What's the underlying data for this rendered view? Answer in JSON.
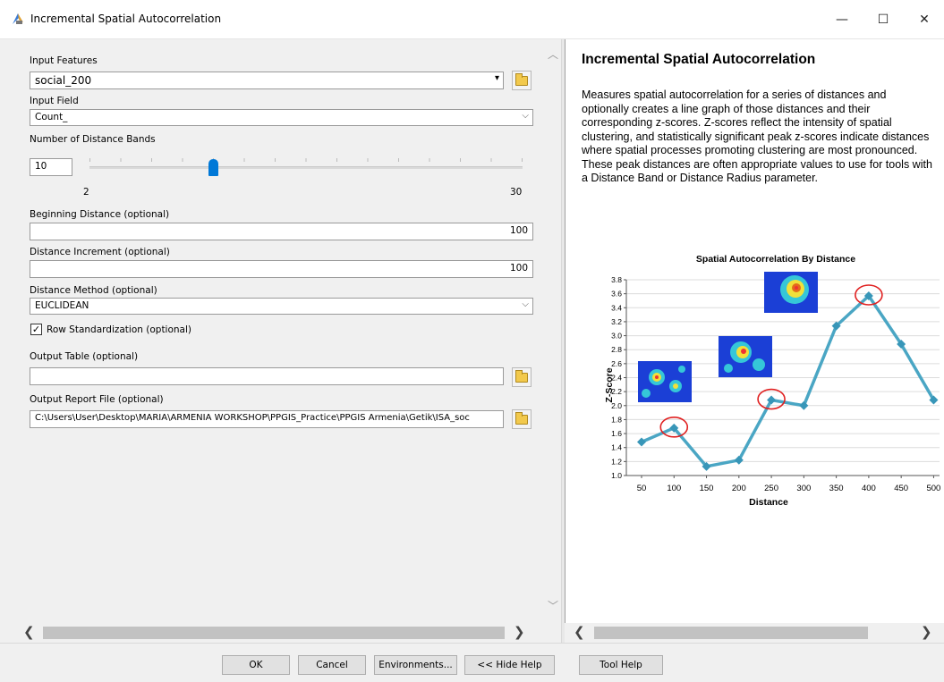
{
  "window": {
    "title": "Incremental Spatial Autocorrelation",
    "min_glyph": "—",
    "max_glyph": "☐",
    "close_glyph": "✕"
  },
  "form": {
    "input_features": {
      "label": "Input Features",
      "value": "social_200"
    },
    "input_field": {
      "label": "Input Field",
      "value": "Count_"
    },
    "distance_bands": {
      "label": "Number of Distance Bands",
      "value": "10",
      "min": "2",
      "max": "30",
      "position": 0.2857
    },
    "beginning_distance": {
      "label": "Beginning Distance (optional)",
      "value": "100"
    },
    "distance_increment": {
      "label": "Distance Increment (optional)",
      "value": "100"
    },
    "distance_method": {
      "label": "Distance Method (optional)",
      "value": "EUCLIDEAN"
    },
    "row_standardization": {
      "label": "Row Standardization (optional)",
      "checked": true
    },
    "output_table": {
      "label": "Output Table (optional)",
      "value": ""
    },
    "output_report": {
      "label": "Output Report File (optional)",
      "value": "C:\\Users\\User\\Desktop\\MARIA\\ARMENIA WORKSHOP\\PPGIS_Practice\\PPGIS Armenia\\Getik\\ISA_soc"
    }
  },
  "help": {
    "title": "Incremental Spatial Autocorrelation",
    "body": "Measures spatial autocorrelation for a series of distances and optionally creates a line graph of those distances and their corresponding z-scores. Z-scores reflect the intensity of spatial clustering, and statistically significant peak z-scores indicate distances where spatial processes promoting clustering are most pronounced. These peak distances are often appropriate values to use for tools with a Distance Band or Distance Radius parameter."
  },
  "chart_data": {
    "type": "line",
    "title": "Spatial Autocorrelation By Distance",
    "xlabel": "Distance",
    "ylabel": "Z-Score",
    "x": [
      50,
      100,
      150,
      200,
      250,
      300,
      350,
      400,
      450,
      500
    ],
    "values": [
      1.48,
      1.68,
      1.13,
      1.22,
      2.08,
      2.0,
      3.14,
      3.57,
      2.88,
      2.08
    ],
    "ylim": [
      1.0,
      3.8
    ],
    "yticks": [
      "1.0",
      "1.2",
      "1.4",
      "1.6",
      "1.8",
      "2.0",
      "2.2",
      "2.4",
      "2.6",
      "2.8",
      "3.0",
      "3.2",
      "3.4",
      "3.6",
      "3.8"
    ],
    "xticks": [
      "50",
      "100",
      "150",
      "200",
      "250",
      "300",
      "350",
      "400",
      "450",
      "500"
    ],
    "highlighted": [
      100,
      250,
      400
    ],
    "grid": true,
    "line_color": "#4aa6c4"
  },
  "buttons": {
    "ok": "OK",
    "cancel": "Cancel",
    "environments": "Environments...",
    "hide_help": "<< Hide Help",
    "tool_help": "Tool Help"
  }
}
